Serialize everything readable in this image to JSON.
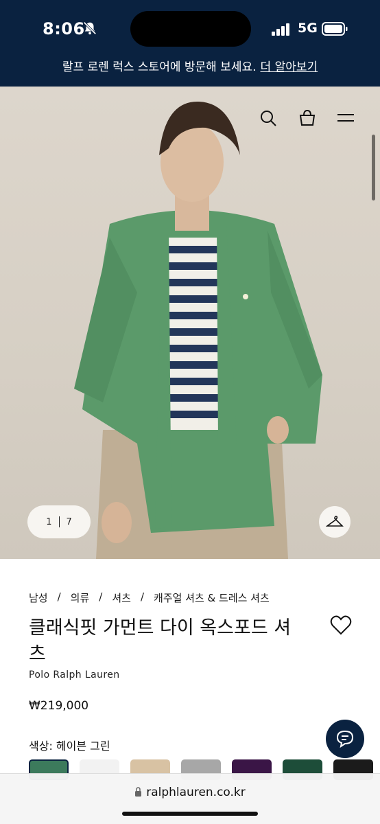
{
  "status_bar": {
    "time": "8:06",
    "network": "5G"
  },
  "promo": {
    "text": "랄프 로렌 럭스 스토어에 방문해 보세요.",
    "link": "더 알아보기"
  },
  "gallery": {
    "current": "1",
    "total": "7"
  },
  "breadcrumb": [
    "남성",
    "의류",
    "셔츠",
    "캐주얼 셔츠 & 드레스 셔츠"
  ],
  "product": {
    "title": "클래식핏 가먼트 다이 옥스포드 셔츠",
    "brand": "Polo Ralph Lauren",
    "price": "₩219,000",
    "color_label": "색상: 헤이븐 그린"
  },
  "swatches": [
    {
      "name": "haven-green",
      "color": "#3c7a5c"
    },
    {
      "name": "white",
      "color": "#f2f2f2"
    },
    {
      "name": "beige",
      "color": "#d8c2a3"
    },
    {
      "name": "grey",
      "color": "#a7a7a7"
    },
    {
      "name": "purple",
      "color": "#3a1546"
    },
    {
      "name": "forest-green",
      "color": "#1d4d39"
    },
    {
      "name": "black",
      "color": "#1b1b1b"
    }
  ],
  "browser": {
    "url": "ralphlauren.co.kr"
  },
  "colors": {
    "navy": "#0a2240",
    "shirt_green": "#5b9a6a"
  }
}
